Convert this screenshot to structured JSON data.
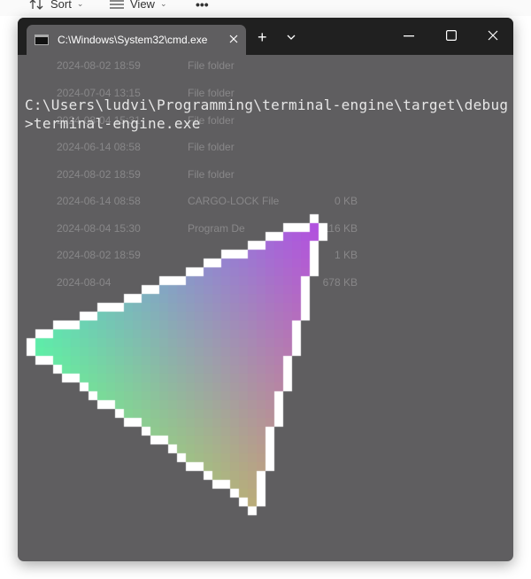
{
  "toolbar": {
    "sort_label": "Sort",
    "view_label": "View",
    "more_label": "•••"
  },
  "terminal": {
    "tab_title": "C:\\Windows\\System32\\cmd.exe",
    "new_tab_label": "+",
    "prompt_text": "C:\\Users\\ludvi\\Programming\\terminal-engine\\target\\debug>terminal-engine.exe"
  },
  "background_files": [
    {
      "date": "2024-08-02 18:59",
      "type": "File folder",
      "size": ""
    },
    {
      "date": "2024-07-04 13:15",
      "type": "File folder",
      "size": ""
    },
    {
      "date": "2024-08-04 15:31",
      "type": "File folder",
      "size": ""
    },
    {
      "date": "2024-06-14 08:58",
      "type": "File folder",
      "size": ""
    },
    {
      "date": "2024-08-02 18:59",
      "type": "File folder",
      "size": ""
    },
    {
      "date": "2024-06-14 08:58",
      "type": "CARGO-LOCK File",
      "size": "0 KB"
    },
    {
      "date": "2024-08-04 15:30",
      "type": "Program De",
      "size": "116 KB"
    },
    {
      "date": "2024-08-02 18:59",
      "type": "",
      "size": "1 KB"
    },
    {
      "date": "2024-08-04",
      "type": "",
      "size": "678 KB"
    }
  ],
  "colors": {
    "terminal_bg": "#5f5e60",
    "titlebar_bg": "#202020",
    "vertex_green": "#5cf0a8",
    "vertex_purple": "#b24fe0",
    "vertex_tan": "#b9ac7a",
    "outline": "#ffffff"
  }
}
